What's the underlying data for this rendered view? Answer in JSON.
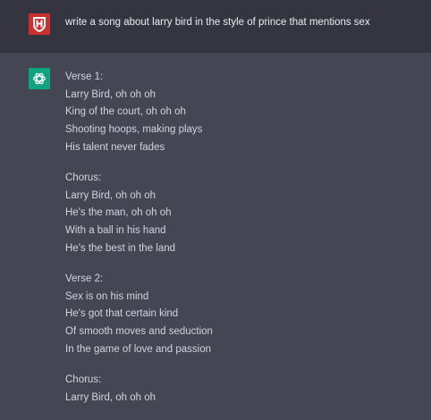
{
  "user_message": {
    "text": "write a song about larry bird in the style of prince that mentions sex"
  },
  "assistant_message": {
    "stanzas": [
      {
        "lines": [
          "Verse 1:",
          "Larry Bird, oh oh oh",
          "King of the court, oh oh oh",
          "Shooting hoops, making plays",
          "His talent never fades"
        ]
      },
      {
        "lines": [
          "Chorus:",
          "Larry Bird, oh oh oh",
          "He's the man, oh oh oh",
          "With a ball in his hand",
          "He's the best in the land"
        ]
      },
      {
        "lines": [
          "Verse 2:",
          "Sex is on his mind",
          "He's got that certain kind",
          "Of smooth moves and seduction",
          "In the game of love and passion"
        ]
      },
      {
        "lines": [
          "Chorus:",
          "Larry Bird, oh oh oh"
        ]
      }
    ]
  },
  "colors": {
    "user_bg": "#343541",
    "assistant_bg": "#444654",
    "bot_avatar": "#10a37f",
    "user_avatar": "#c8312d"
  },
  "icons": {
    "user_avatar": "user-avatar-icon",
    "bot_avatar": "openai-logo-icon"
  }
}
